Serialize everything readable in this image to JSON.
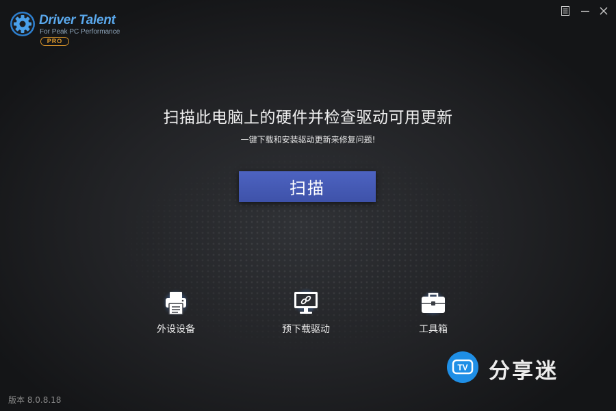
{
  "app": {
    "name": "Driver Talent",
    "tagline": "For Peak PC Performance",
    "edition": "PRO",
    "brand_color": "#5aa8ec",
    "edition_color": "#e09a2c"
  },
  "window_controls": {
    "menu_icon": "menu-icon",
    "minimize_icon": "minimize-icon",
    "close_icon": "close-icon"
  },
  "main": {
    "headline": "扫描此电脑上的硬件并检查驱动可用更新",
    "subline": "一键下载和安装驱动更新来修复问题!",
    "scan_button": "扫描",
    "scan_button_color": "#4459b4"
  },
  "features": [
    {
      "label": "外设设备",
      "icon": "printer-icon"
    },
    {
      "label": "预下载驱动",
      "icon": "monitor-download-icon"
    },
    {
      "label": "工具箱",
      "icon": "toolbox-icon"
    }
  ],
  "watermark": {
    "icon_text": "TV",
    "text": "分享迷",
    "color": "#1f8fe6"
  },
  "footer": {
    "version": "版本 8.0.8.18"
  }
}
